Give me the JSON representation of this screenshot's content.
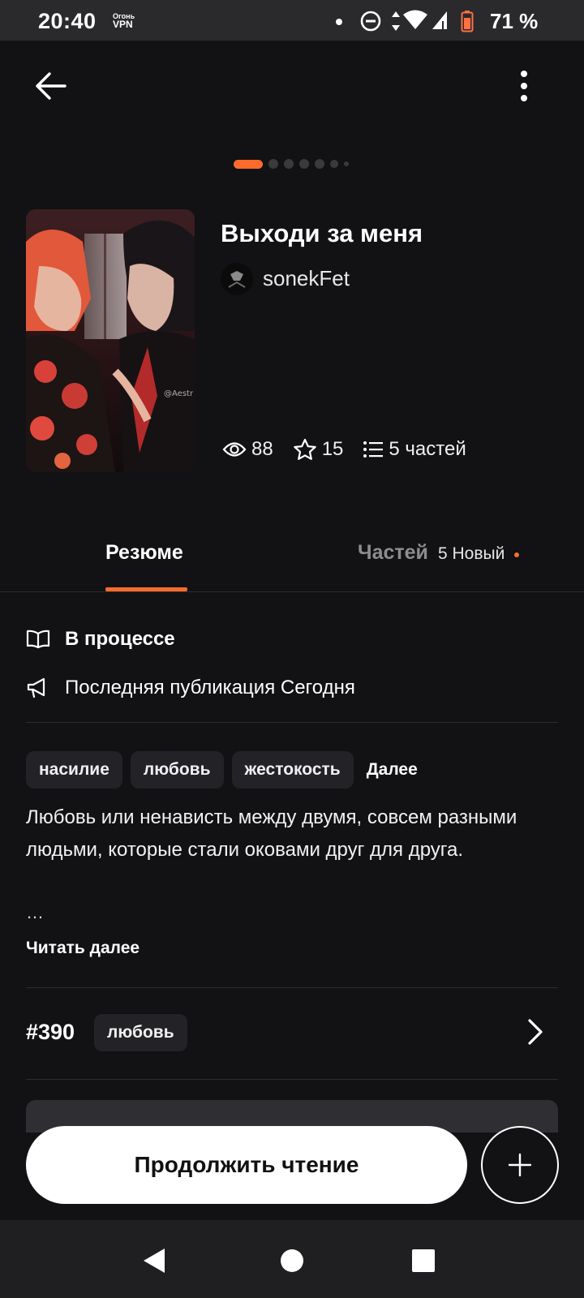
{
  "status_bar": {
    "time": "20:40",
    "vpn_line1": "Огонь",
    "vpn_line2": "VPN",
    "battery": "71 %",
    "icons": [
      "notification-dot",
      "do-not-disturb-icon",
      "data-arrows-icon",
      "wifi-icon",
      "signal-icon",
      "battery-icon"
    ]
  },
  "header": {
    "back_icon": "arrow-left-icon",
    "menu_icon": "more-vertical-icon"
  },
  "pager": {
    "total": 7,
    "active": 1
  },
  "story": {
    "title": "Выходи за меня",
    "author": "sonekFet",
    "cover_watermark": "@Aestr",
    "views": "88",
    "votes": "15",
    "parts": "5 частей"
  },
  "tabs": {
    "summary": "Резюме",
    "parts": "Частей",
    "parts_new": "5 Новый"
  },
  "info": {
    "status": "В процессе",
    "last_published": "Последняя публикация Сегодня"
  },
  "tags": [
    "насилие",
    "любовь",
    "жестокость"
  ],
  "tags_more": "Далее",
  "description": "Любовь или ненависть между двумя, совсем разными людьми, которые стали оковами друг для друга.",
  "ellipsis": "…",
  "read_more": "Читать далее",
  "ranking": {
    "rank": "#390",
    "tag": "любовь"
  },
  "actions": {
    "continue": "Продолжить чтение",
    "add_icon": "plus-icon"
  },
  "colors": {
    "accent": "#ff6b2c",
    "background": "#121114",
    "chip": "#232226"
  }
}
